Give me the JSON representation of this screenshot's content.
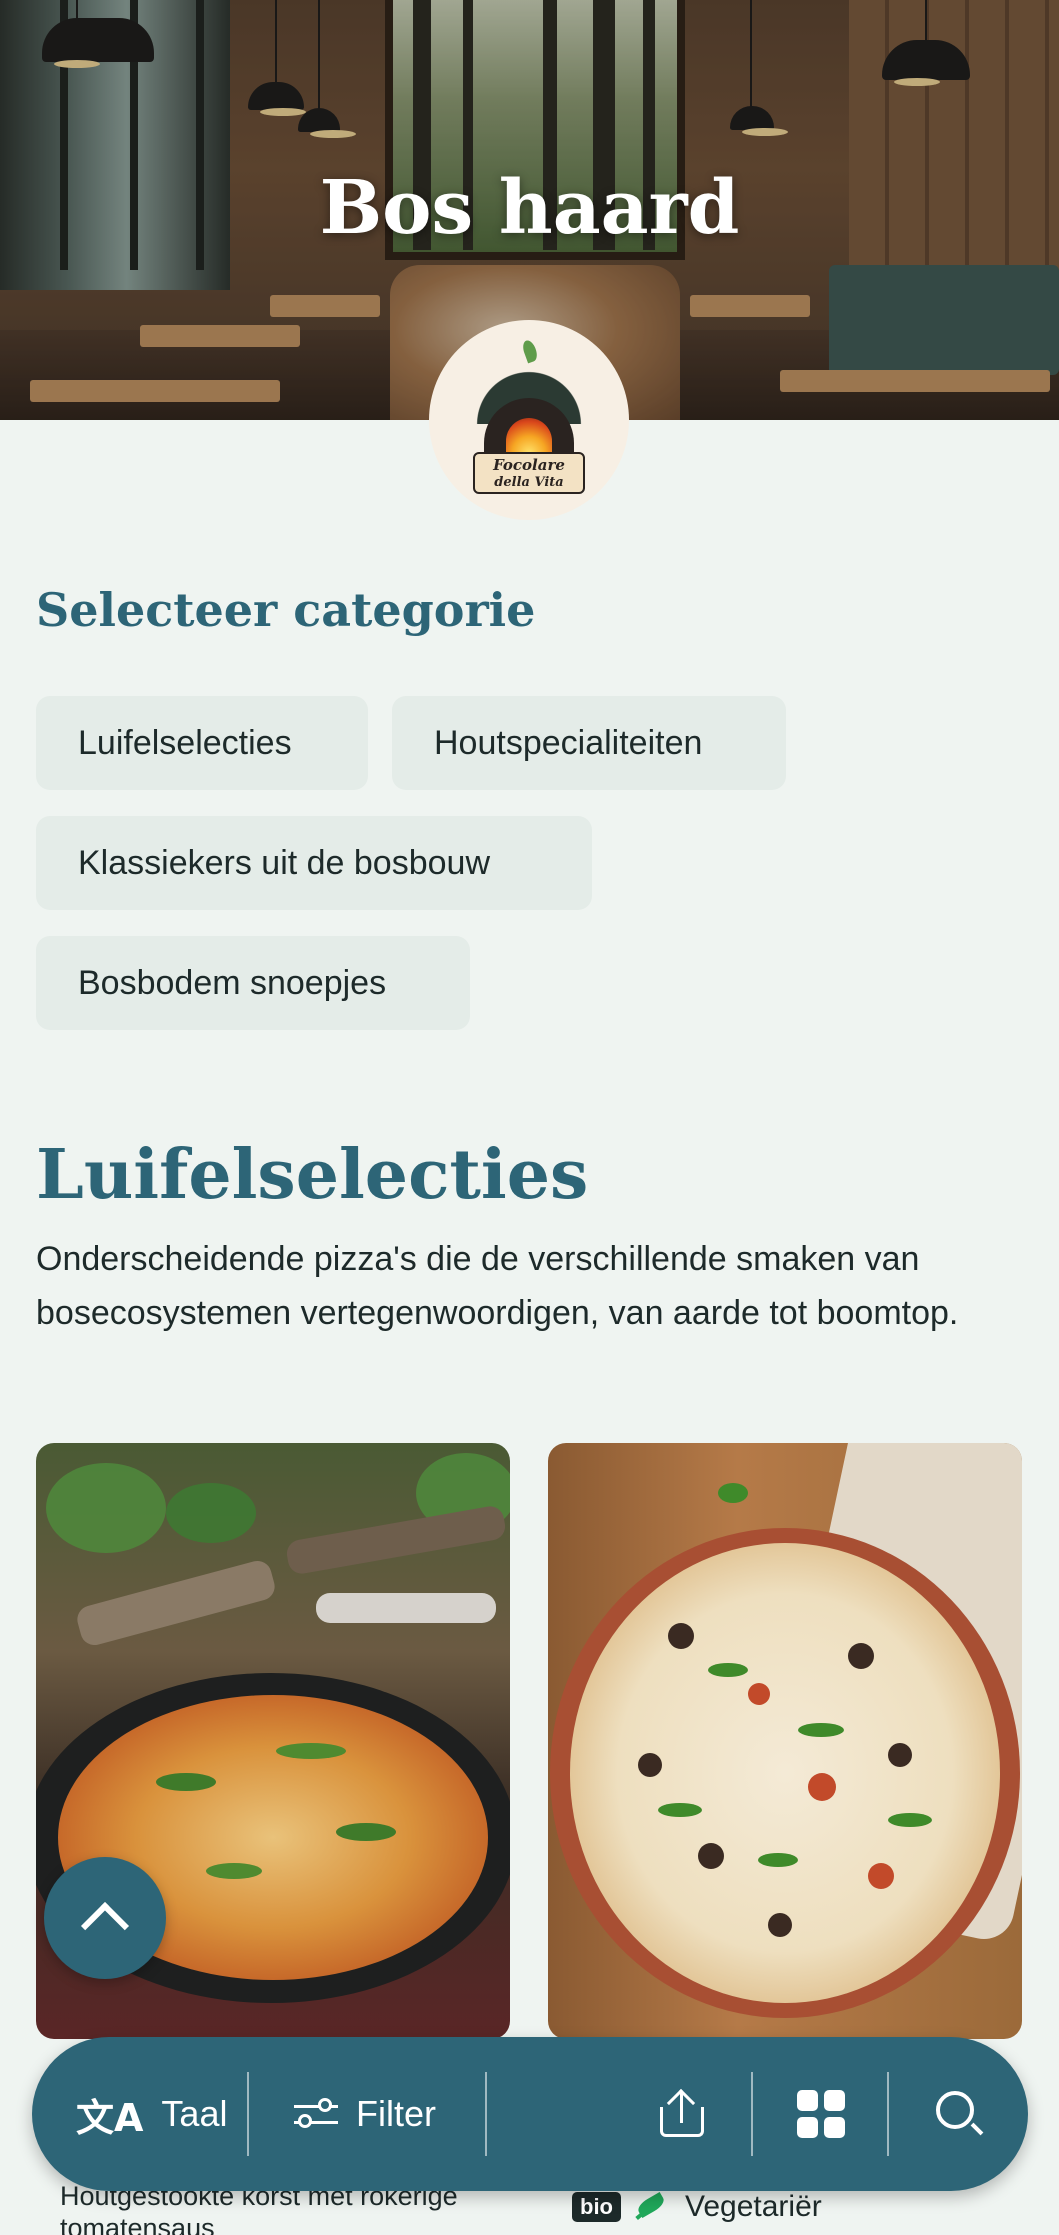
{
  "colors": {
    "accent": "#2d6577",
    "background": "#eff4f1",
    "chip_bg": "#e4ece8",
    "text": "#1d2a2a"
  },
  "hero": {
    "title": "Bos haard",
    "logo": {
      "line1": "Focolare",
      "line2": "della Vita"
    }
  },
  "category_picker": {
    "heading": "Selecteer categorie",
    "chips": [
      "Luifelselecties",
      "Houtspecialiteiten",
      "Klassiekers uit de bosbouw",
      "Bosbodem snoepjes"
    ]
  },
  "category": {
    "title": "Luifelselecties",
    "description": "Onderscheidende pizza's die de verschillende smaken van bosecosystemen vertegenwoordigen, van aarde tot boomtop.",
    "items": [
      {
        "image": "pizza-in-cast-iron-pan-photo",
        "text": "Houtgestookte korst met rokerige tomatensaus"
      },
      {
        "image": "pizza-on-terracotta-plate-photo",
        "badge": "bio",
        "tag_icon": "vegetarian-icon",
        "tag": "Vegetariër"
      }
    ]
  },
  "bottom_bar": {
    "language_label": "Taal",
    "language_icon": "translate-icon",
    "filter_label": "Filter",
    "filter_icon": "filter-icon",
    "share_icon": "share-icon",
    "grid_icon": "grid-view-icon",
    "search_icon": "search-icon"
  },
  "scroll_top_icon": "chevron-up-icon"
}
